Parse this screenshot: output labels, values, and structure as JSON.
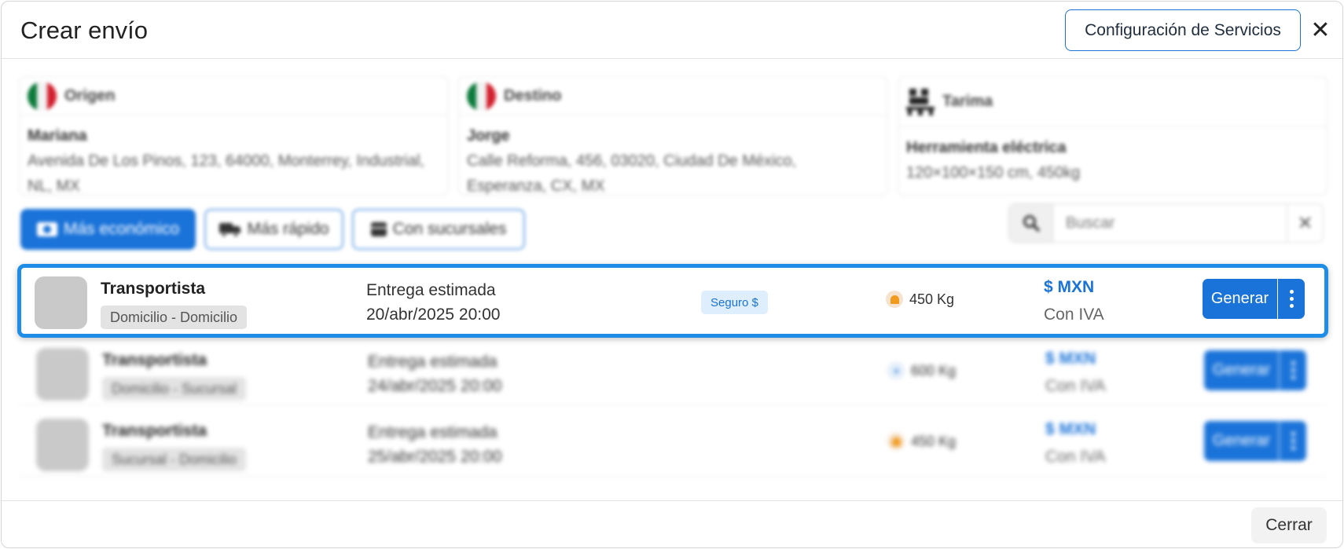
{
  "modal": {
    "title": "Crear envío",
    "config_button": "Configuración de Servicios",
    "close_icon": "close-icon"
  },
  "origin": {
    "label": "Origen",
    "flag": "mexico-flag-icon",
    "name": "Mariana",
    "address": "Avenida De Los Pinos, 123, 64000, Monterrey, Industrial, NL, MX"
  },
  "destination": {
    "label": "Destino",
    "flag": "mexico-flag-icon",
    "name": "Jorge",
    "address": "Calle Reforma, 456, 03020, Ciudad De México, Esperanza, CX, MX"
  },
  "package": {
    "label": "Tarima",
    "icon": "pallet-icon",
    "name": "Herramienta eléctrica",
    "details": "120×100×150 cm, 450kg"
  },
  "filters": [
    {
      "label": "Más económico",
      "icon": "money-icon",
      "active": true
    },
    {
      "label": "Más rápido",
      "icon": "truck-icon",
      "active": false
    },
    {
      "label": "Con sucursales",
      "icon": "store-icon",
      "active": false
    }
  ],
  "search": {
    "placeholder": "Buscar",
    "icon": "search-icon"
  },
  "rates": [
    {
      "carrier": "Transportista",
      "route": "Domicilio - Domicilio",
      "eta_label": "Entrega estimada",
      "eta_date": "20/abr/2025 20:00",
      "insurance": "Seguro $",
      "weight": "450 Kg",
      "price": "$ MXN",
      "tax": "Con IVA",
      "action": "Generar"
    },
    {
      "carrier": "Transportista",
      "route": "Domicilio - Sucursal",
      "eta_label": "Entrega estimada",
      "eta_date": "24/abr/2025 20:00",
      "weight": "600 Kg",
      "price": "$ MXN",
      "tax": "Con IVA",
      "action": "Generar"
    },
    {
      "carrier": "Transportista",
      "route": "Sucursal - Domicilio",
      "eta_label": "Entrega estimada",
      "eta_date": "25/abr/2025 20:00",
      "weight": "450 Kg",
      "price": "$ MXN",
      "tax": "Con IVA",
      "action": "Generar"
    }
  ],
  "footer": {
    "close_button": "Cerrar"
  },
  "colors": {
    "primary": "#1a73d9",
    "highlight_border": "#1e8de8"
  }
}
